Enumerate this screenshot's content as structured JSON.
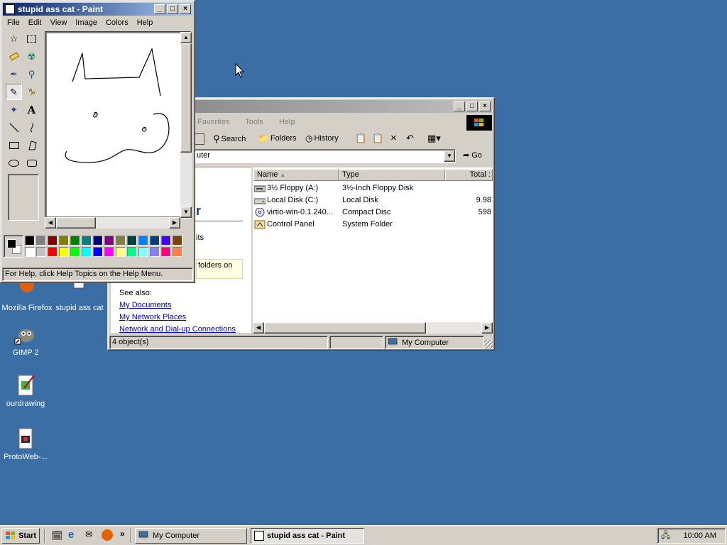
{
  "desktop": {
    "icons": [
      {
        "label": "Mozilla Firefox"
      },
      {
        "label": "stupid ass cat"
      },
      {
        "label": "GIMP 2"
      },
      {
        "label": "ourdrawing"
      },
      {
        "label": "ProtoWeb-..."
      }
    ]
  },
  "paint": {
    "title": "stupid ass cat - Paint",
    "menu": [
      "File",
      "Edit",
      "View",
      "Image",
      "Colors",
      "Help"
    ],
    "status": "For Help, click Help Topics on the Help Menu.",
    "tool_text_glyph": "A",
    "palette_top": [
      "#000000",
      "#808080",
      "#800000",
      "#808000",
      "#008000",
      "#008080",
      "#000080",
      "#800080",
      "#808040",
      "#004040",
      "#0080ff",
      "#004080",
      "#4000ff",
      "#804000"
    ],
    "palette_bottom": [
      "#ffffff",
      "#c0c0c0",
      "#ff0000",
      "#ffff00",
      "#00ff00",
      "#00ffff",
      "#0000ff",
      "#ff00ff",
      "#ffff80",
      "#00ff80",
      "#80ffff",
      "#8080ff",
      "#ff0080",
      "#ff8040"
    ],
    "foreground": "#000000",
    "background": "#ffffff"
  },
  "explorer": {
    "title": "My Computer",
    "menu": [
      "Favorites",
      "Tools",
      "Help"
    ],
    "toolbar": {
      "search": "Search",
      "folders": "Folders",
      "history": "History"
    },
    "address_value": "uter",
    "go_label": "Go",
    "columns": {
      "name": "Name",
      "type": "Type",
      "total": "Total :"
    },
    "rows": [
      {
        "name": "3½ Floppy (A:)",
        "type": "3½-Inch Floppy Disk",
        "total": ""
      },
      {
        "name": "Local Disk (C:)",
        "type": "Local Disk",
        "total": "9.98"
      },
      {
        "name": "virtio-win-0.1.240...",
        "type": "Compact Disc",
        "total": "598"
      },
      {
        "name": "Control Panel",
        "type": "System Folder",
        "total": ""
      }
    ],
    "left_pane": {
      "heading_fragment": "r",
      "text_fragment": "its",
      "tip_fragment": "folders on",
      "see_also": "See also:",
      "links": [
        "My Documents",
        "My Network Places",
        "Network and Dial-up Connections"
      ]
    },
    "status": {
      "count": "4 object(s)",
      "zone": "My Computer"
    }
  },
  "taskbar": {
    "start": "Start",
    "quicklaunch_more": "»",
    "tasks": [
      {
        "label": "My Computer"
      },
      {
        "label": "stupid ass cat - Paint"
      }
    ],
    "clock": "10:00 AM"
  },
  "colors": {
    "desktop": "#3a6ea5",
    "title_active": "#0a246a",
    "face": "#d4d0c8"
  }
}
